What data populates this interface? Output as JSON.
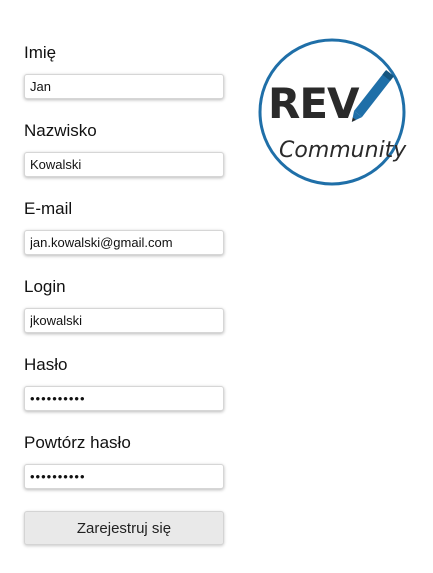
{
  "form": {
    "first_name": {
      "label": "Imię",
      "value": "Jan"
    },
    "last_name": {
      "label": "Nazwisko",
      "value": "Kowalski"
    },
    "email": {
      "label": "E-mail",
      "value": "jan.kowalski@gmail.com"
    },
    "login": {
      "label": "Login",
      "value": "jkowalski"
    },
    "password": {
      "label": "Hasło",
      "value": "••••••••••"
    },
    "password_repeat": {
      "label": "Powtórz hasło",
      "value": "••••••••••"
    },
    "submit_label": "Zarejestruj się"
  },
  "logo": {
    "brand": "REV",
    "tagline": "Community",
    "icon": "pencil-icon",
    "colors": {
      "ring": "#1f6fa8",
      "text": "#2a2a2a",
      "pencil": "#1f6fa8"
    }
  }
}
